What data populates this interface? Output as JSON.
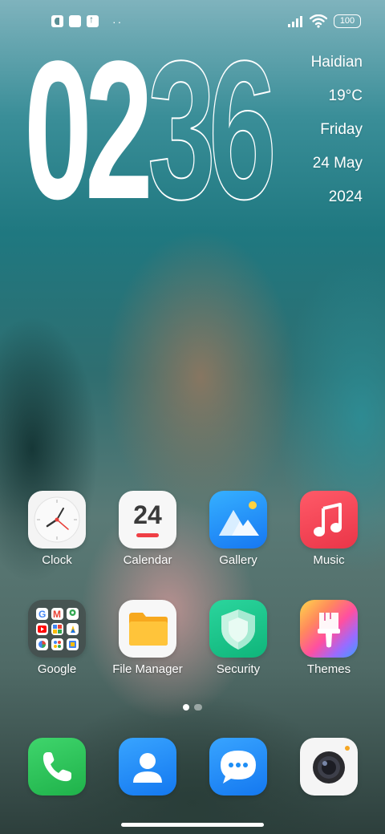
{
  "status_bar": {
    "left_icons": [
      "notification-app-icon",
      "square-notification-icon",
      "upload-icon"
    ],
    "overflow": "··",
    "right_icons": [
      "signal-icon",
      "wifi-icon"
    ],
    "battery": "100"
  },
  "clock": {
    "hour_tens": "0",
    "hour_ones": "2",
    "minute_tens": "3",
    "minute_ones": "6"
  },
  "weather": {
    "city": "Haidian",
    "temperature": "19°C",
    "weekday": "Friday",
    "date": "24 May",
    "year": "2024"
  },
  "apps": [
    {
      "label": "Clock"
    },
    {
      "label": "Calendar",
      "badge": "24"
    },
    {
      "label": "Gallery"
    },
    {
      "label": "Music"
    },
    {
      "label": "Google"
    },
    {
      "label": "File Manager"
    },
    {
      "label": "Security"
    },
    {
      "label": "Themes"
    }
  ],
  "page_indicator": {
    "pages": 2,
    "current": 1
  },
  "dock": [
    {
      "name": "phone"
    },
    {
      "name": "contacts"
    },
    {
      "name": "messages"
    },
    {
      "name": "camera"
    }
  ],
  "colors": {
    "gallery": "#1e8ff8",
    "music": "#f2485a",
    "security": "#17c28a",
    "phone": "#26c55a",
    "contacts": "#1d8ef5",
    "messages": "#1d8ef5"
  }
}
